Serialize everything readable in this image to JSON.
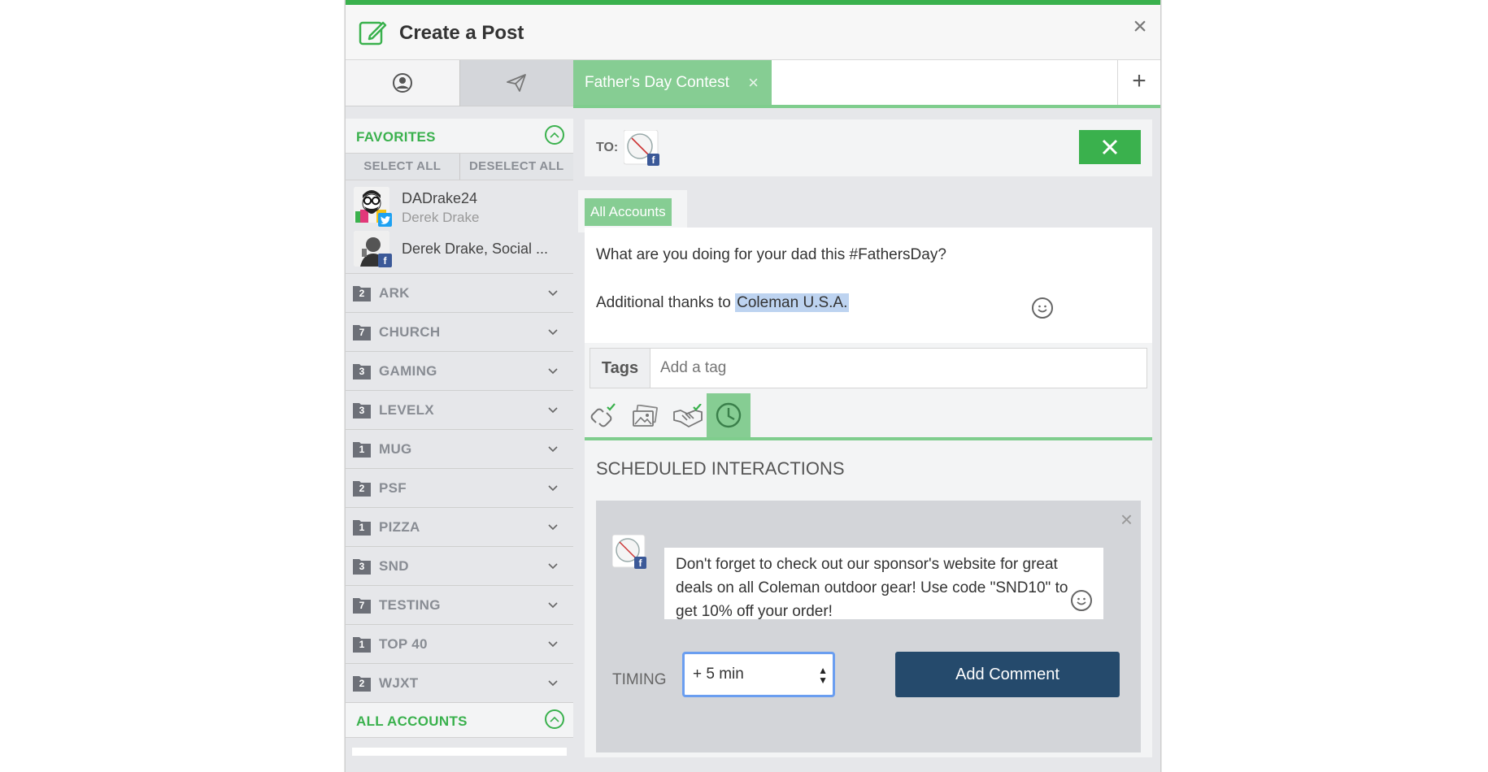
{
  "header": {
    "title": "Create a Post",
    "close": "×"
  },
  "left": {
    "favorites_label": "FAVORITES",
    "select_all": "SELECT ALL",
    "deselect_all": "DESELECT ALL",
    "accounts": [
      {
        "name": "DADrake24",
        "handle": "Derek Drake",
        "network": "twitter"
      },
      {
        "name": "Derek Drake, Social ...",
        "handle": "",
        "network": "facebook"
      }
    ],
    "groups": [
      {
        "count": "2",
        "name": "ARK"
      },
      {
        "count": "7",
        "name": "CHURCH"
      },
      {
        "count": "3",
        "name": "GAMING"
      },
      {
        "count": "3",
        "name": "LEVELX"
      },
      {
        "count": "1",
        "name": "MUG"
      },
      {
        "count": "2",
        "name": "PSF"
      },
      {
        "count": "1",
        "name": "PIZZA"
      },
      {
        "count": "3",
        "name": "SND"
      },
      {
        "count": "7",
        "name": "TESTING"
      },
      {
        "count": "1",
        "name": "TOP 40"
      },
      {
        "count": "2",
        "name": "WJXT"
      }
    ],
    "all_accounts_label": "ALL ACCOUNTS"
  },
  "right": {
    "post_tab": "Father's Day Contest",
    "post_tab_close": "×",
    "add_tab": "+",
    "to_label": "TO:",
    "account_tab": "All Accounts",
    "message_line1": "What are you doing for your dad this #FathersDay?",
    "message_line2_prefix": "Additional thanks to ",
    "message_line2_tag": "Coleman U.S.A.",
    "tags_label": "Tags",
    "tags_placeholder": "Add a tag",
    "scheduled_title": "SCHEDULED INTERACTIONS",
    "comment_text": "Don't forget to check out our sponsor's website for great deals on all Coleman outdoor gear! Use code \"SND10\" to get 10% off your order!",
    "timing_label": "TIMING",
    "timing_value": "+ 5 min",
    "add_comment": "Add Comment",
    "card_close": "×"
  },
  "colors": {
    "accent": "#3ab14d",
    "accent_light": "#86cd93",
    "button_dark": "#254a6c",
    "twitter": "#1da1f2",
    "facebook": "#3b5998"
  }
}
